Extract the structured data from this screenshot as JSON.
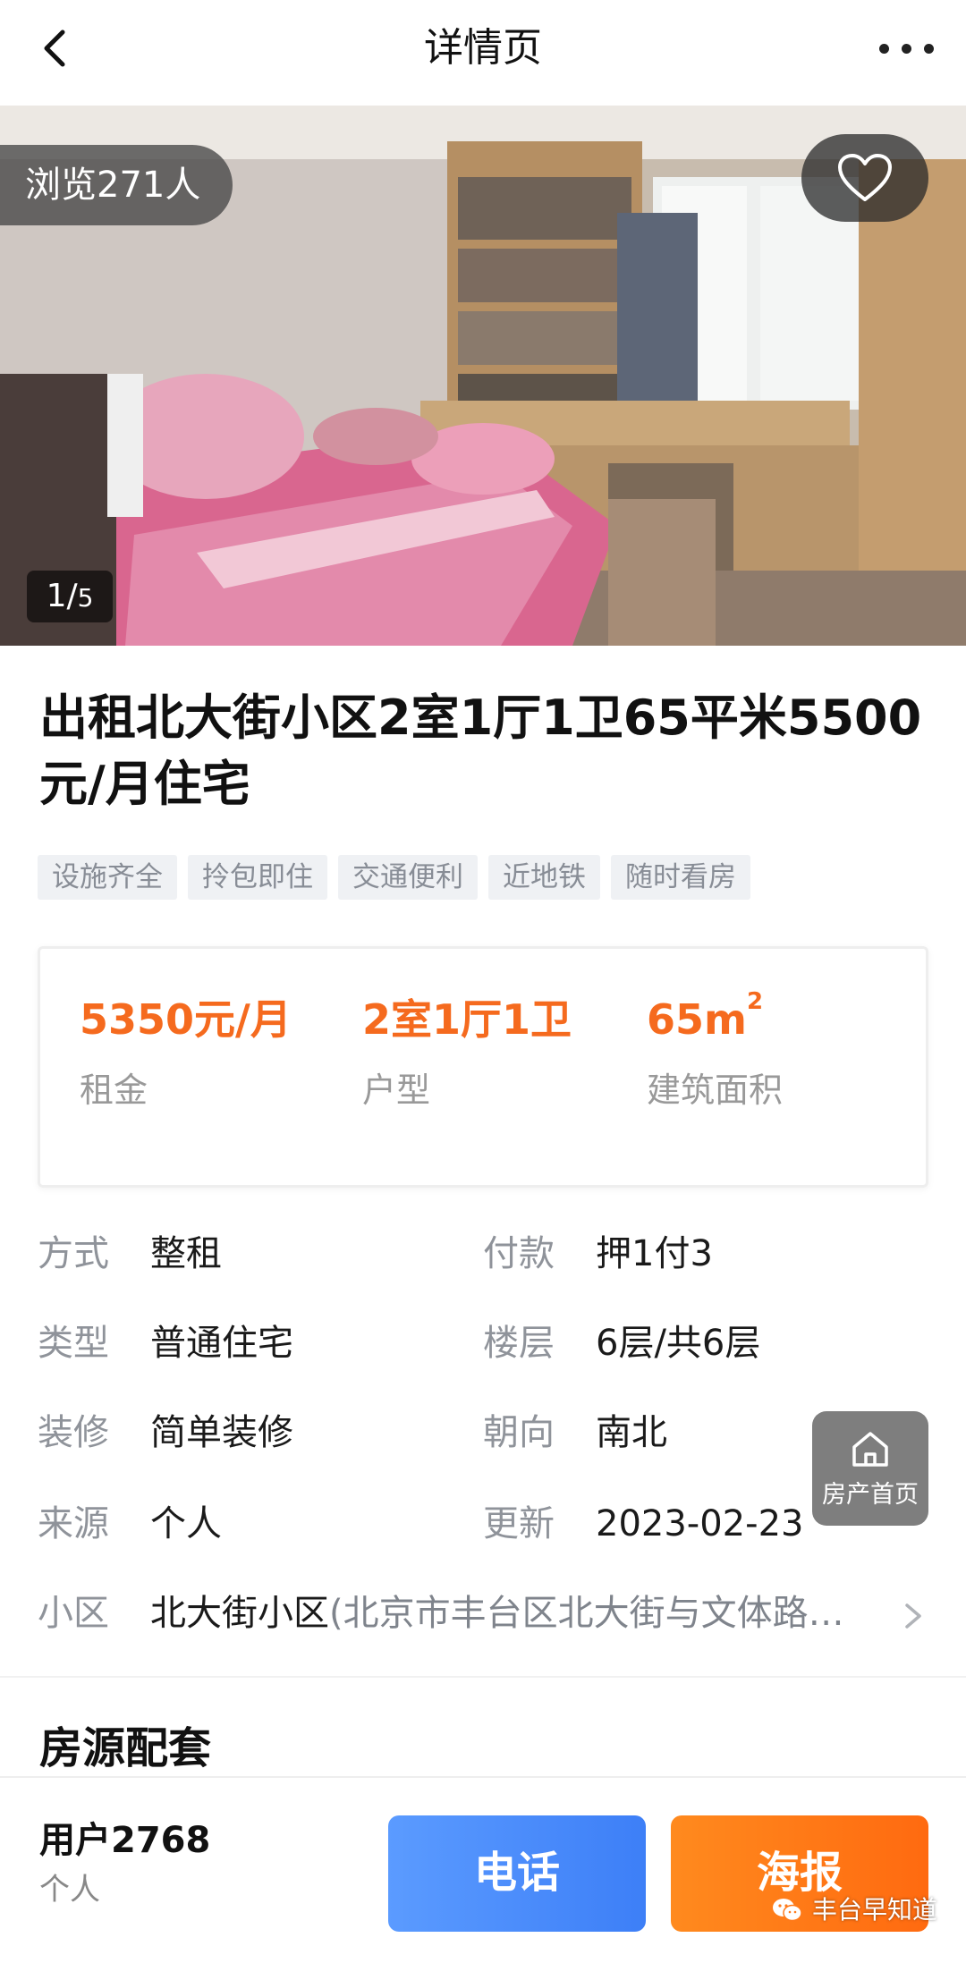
{
  "header": {
    "title": "详情页"
  },
  "gallery": {
    "views": "浏览271人",
    "index_current": "1/",
    "index_total": "5"
  },
  "listing": {
    "title": "出租北大街小区2室1厅1卫65平米5500元/月住宅",
    "tags": [
      "设施齐全",
      "拎包即住",
      "交通便利",
      "近地铁",
      "随时看房"
    ]
  },
  "key_info": {
    "rent_value": "5350元/月",
    "rent_label": "租金",
    "layout_value": "2室1厅1卫",
    "layout_label": "户型",
    "area_value": "65m",
    "area_unit_sup": "2",
    "area_label": "建筑面积"
  },
  "attributes": {
    "mode_label": "方式",
    "mode_value": "整租",
    "payment_label": "付款",
    "payment_value": "押1付3",
    "type_label": "类型",
    "type_value": "普通住宅",
    "floor_label": "楼层",
    "floor_value": "6层/共6层",
    "decoration_label": "装修",
    "decoration_value": "简单装修",
    "orientation_label": "朝向",
    "orientation_value": "南北",
    "source_label": "来源",
    "source_value": "个人",
    "updated_label": "更新",
    "updated_value": "2023-02-23",
    "community_label": "小区",
    "community_value": "北大街小区",
    "community_address": "(北京市丰台区北大街与文体路…"
  },
  "floating": {
    "label": "房产首页"
  },
  "sections": {
    "facilities_title": "房源配套"
  },
  "bottom_bar": {
    "user_name": "用户2768",
    "user_type": "个人",
    "call_label": "电话",
    "poster_label": "海报",
    "watermark": "丰台早知道"
  },
  "colors": {
    "accent_orange": "#f56a1e",
    "call_blue": "#4a8cfa",
    "poster_orange": "#ff7418"
  }
}
